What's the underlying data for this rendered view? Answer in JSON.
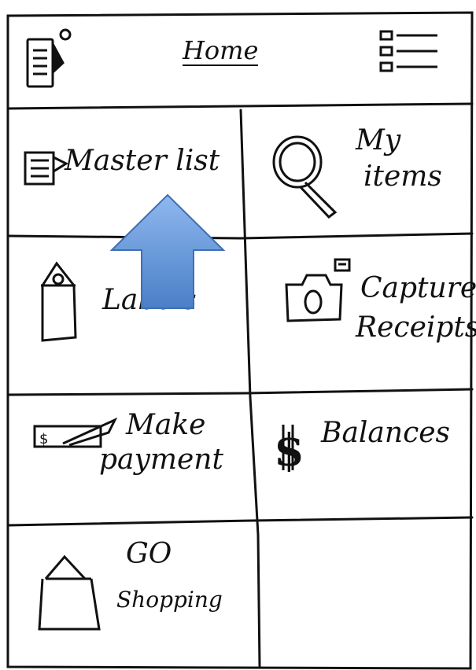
{
  "header": {
    "title": "Home",
    "left_icon": "document-icon",
    "right_icon": "list-menu-icon"
  },
  "tiles": [
    {
      "id": "master-list",
      "label": "Master list",
      "icon": "document-icon"
    },
    {
      "id": "my-items",
      "label_lines": [
        "My",
        "items"
      ],
      "icon": "magnifier-icon"
    },
    {
      "id": "labels",
      "label": "Labels",
      "icon": "tag-icon"
    },
    {
      "id": "capture-receipts",
      "label_lines": [
        "Capture",
        "Receipts"
      ],
      "icon": "camera-icon"
    },
    {
      "id": "make-payment",
      "label_lines": [
        "Make",
        "payment"
      ],
      "icon": "pen-check-icon"
    },
    {
      "id": "balances",
      "label": "Balances",
      "icon": "dollar-icon"
    },
    {
      "id": "go-shopping",
      "label_lines": [
        "GO",
        "Shopping"
      ],
      "icon": "bag-icon"
    }
  ],
  "colors": {
    "ink": "#111111",
    "arrow_fill": "#5b8fd6",
    "arrow_stroke": "#3f6fb3"
  }
}
